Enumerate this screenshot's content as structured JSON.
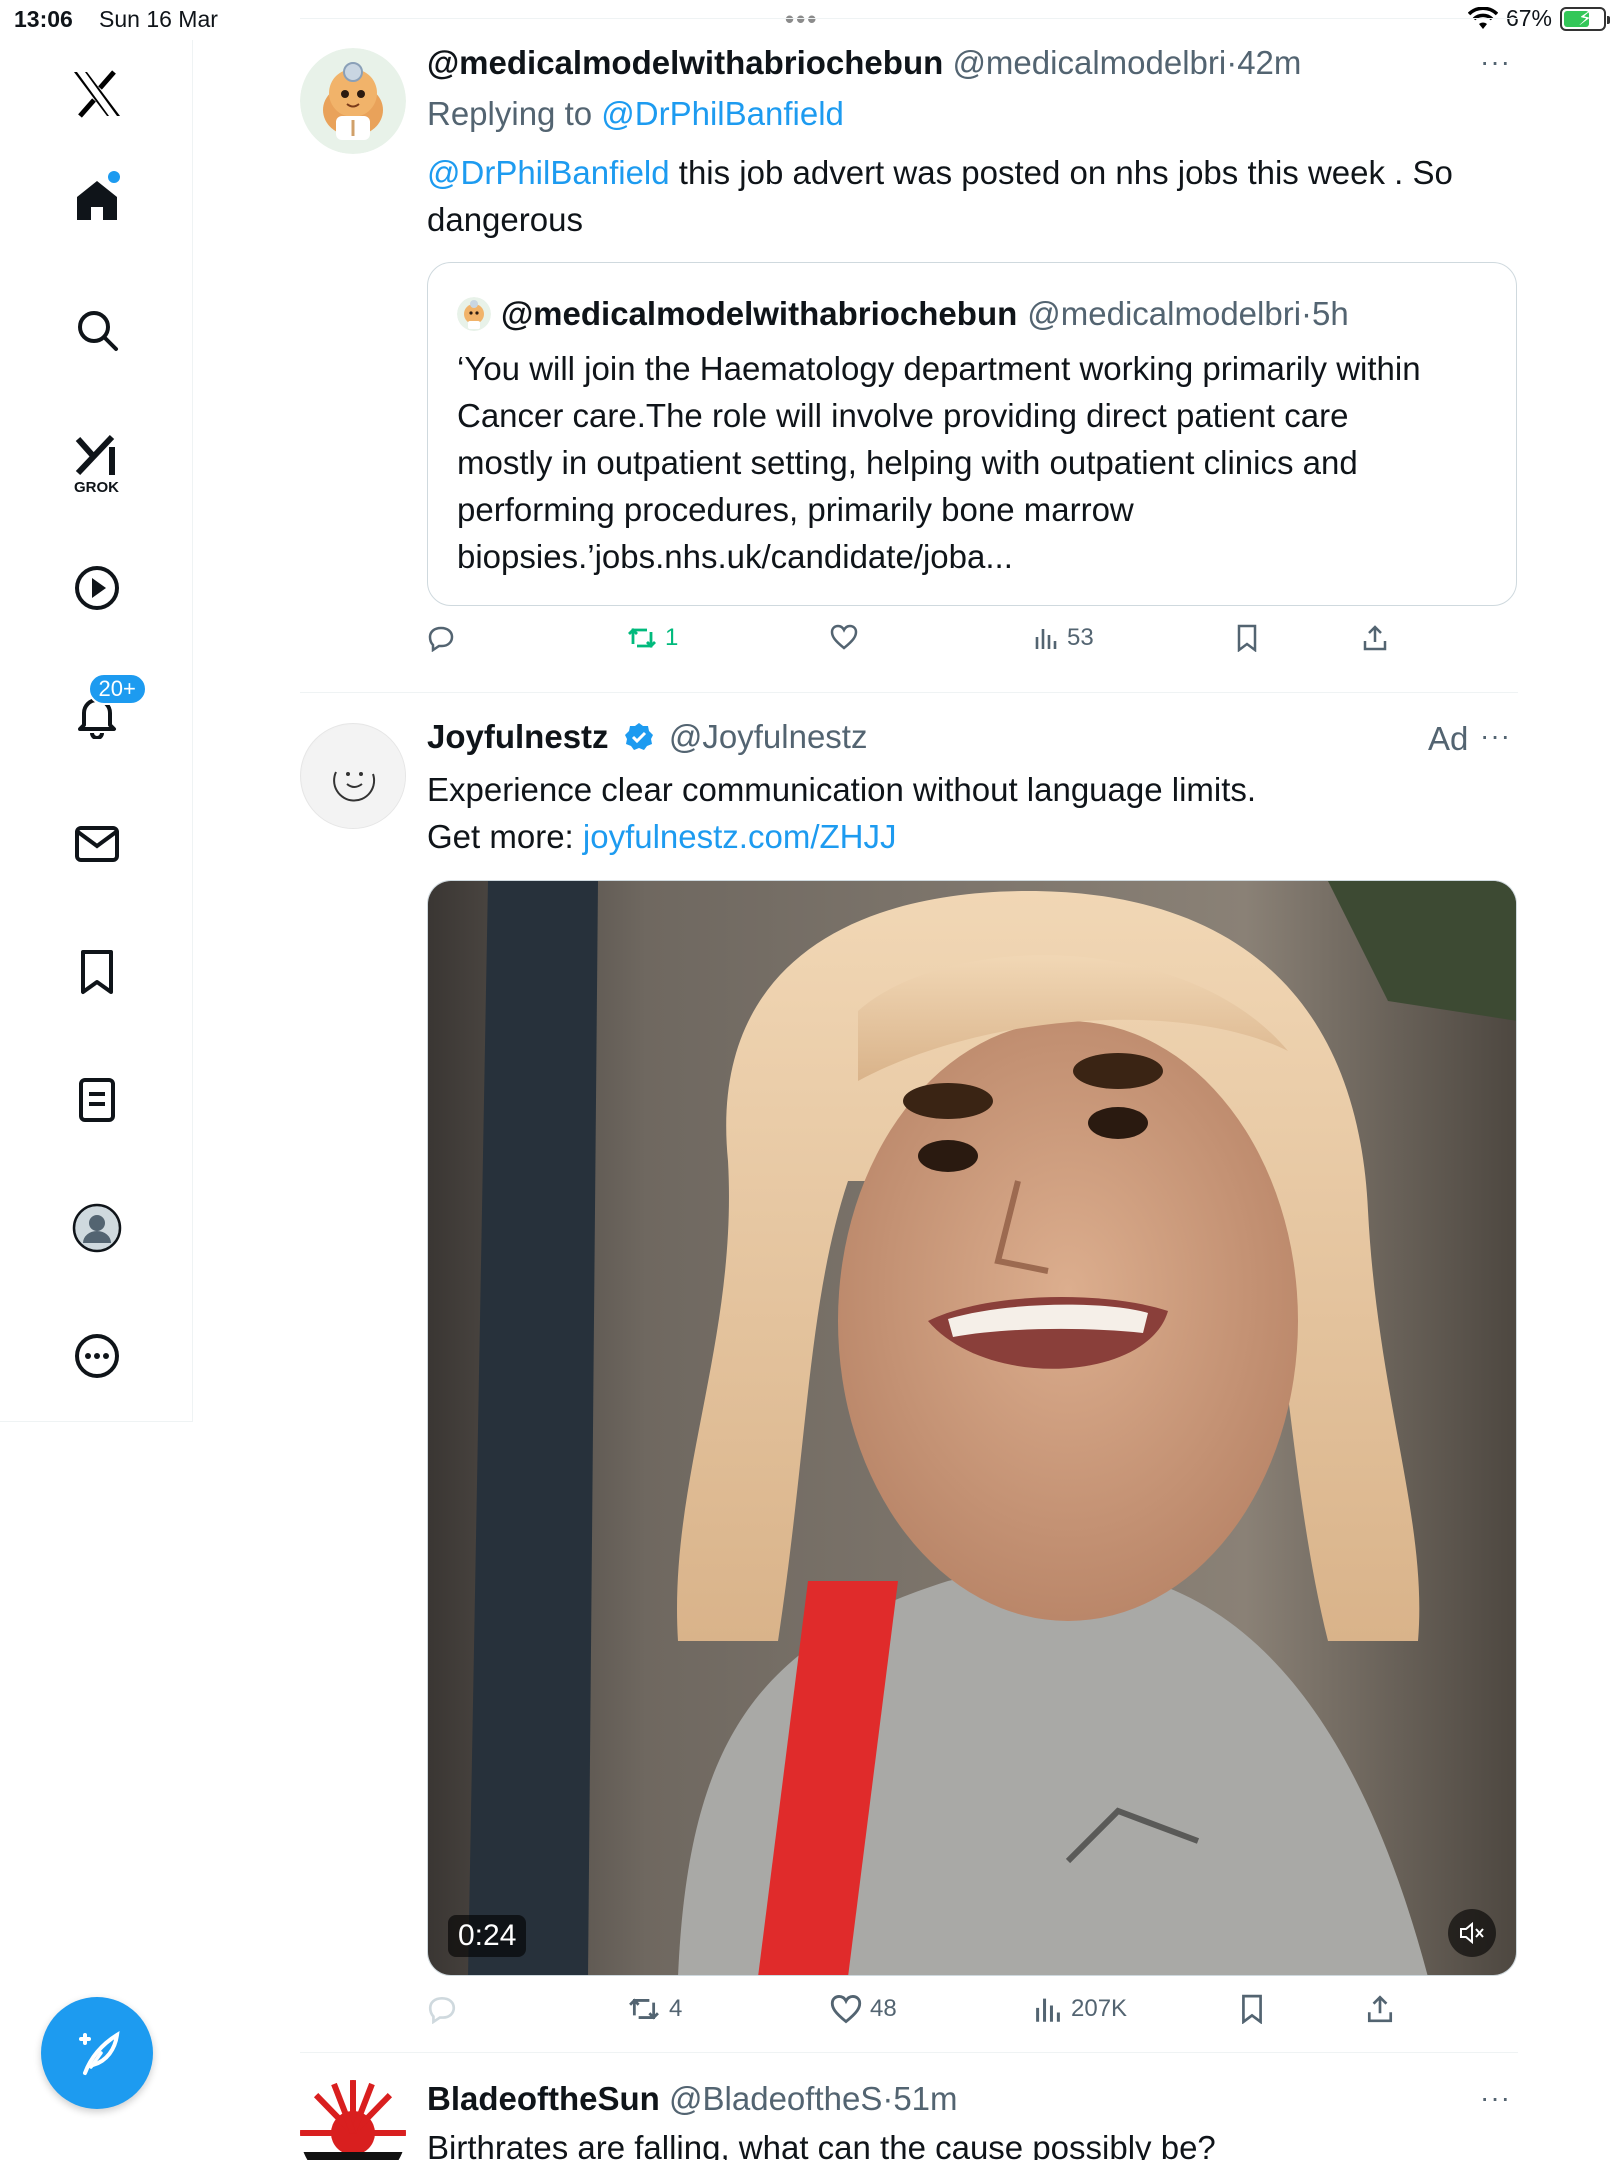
{
  "status_bar": {
    "time": "13:06",
    "date": "Sun 16 Mar",
    "battery_percent": "67%",
    "battery_level": 0.67,
    "multitask_dots": "•••"
  },
  "sidebar": {
    "items": [
      {
        "name": "x-logo",
        "icon": "x-logo-icon"
      },
      {
        "name": "home",
        "icon": "home-icon",
        "has_dot": true
      },
      {
        "name": "explore",
        "icon": "search-icon"
      },
      {
        "name": "grok",
        "icon": "grok-icon",
        "label": "GROK"
      },
      {
        "name": "video",
        "icon": "play-icon"
      },
      {
        "name": "notifications",
        "icon": "bell-icon",
        "badge": "20+"
      },
      {
        "name": "messages",
        "icon": "mail-icon"
      },
      {
        "name": "bookmarks",
        "icon": "bookmark-icon"
      },
      {
        "name": "lists",
        "icon": "list-icon"
      },
      {
        "name": "profile",
        "icon": "profile-avatar"
      },
      {
        "name": "more",
        "icon": "more-circle-icon"
      }
    ],
    "compose_icon": "compose-feather-icon"
  },
  "tweets": [
    {
      "name": "@medicalmodelwithabriochebun",
      "handle": "@medicalmodelbri",
      "sep": "·",
      "time": "42m",
      "more": "···",
      "replying_prefix": "Replying to",
      "replying_to": "@DrPhilBanfield",
      "text_mention": "@DrPhilBanfield",
      "text_line1_rest": " this job advert was posted on nhs jobs this week . So",
      "text_line2": "dangerous",
      "quote": {
        "name": "@medicalmodelwithabriochebun",
        "handle": "@medicalmodelbri",
        "sep": "·",
        "time": "5h",
        "lines": [
          "‘You will join the Haematology department working primarily within",
          "Cancer care.The role will involve providing direct patient care",
          "mostly in outpatient setting, helping with outpatient clinics and",
          "performing procedures, primarily bone marrow",
          "biopsies.’jobs.nhs.uk/candidate/joba..."
        ]
      },
      "actions": {
        "reply": "",
        "retweet": "1",
        "like": "",
        "views": "53"
      }
    },
    {
      "name": "Joyfulnestz",
      "handle": "@Joyfulnestz",
      "ad_label": "Ad",
      "more": "···",
      "text_line1": "Experience clear communication without language limits.",
      "text_line2_prefix": "Get more: ",
      "text_link": "joyfulnestz.com/ZHJJ",
      "video_timecode": "0:24",
      "actions": {
        "reply": "",
        "retweet": "4",
        "like": "48",
        "views": "207K"
      }
    },
    {
      "name": "BladeoftheSun",
      "handle": "@BladeoftheS",
      "sep": "·",
      "time": "51m",
      "more": "···",
      "text": "Birthrates are falling, what can the cause possibly be?"
    }
  ],
  "colors": {
    "accent": "#1d9bf0",
    "retweet_active": "#00ba7c",
    "muted_text": "#536471",
    "border": "#cfd9de"
  }
}
